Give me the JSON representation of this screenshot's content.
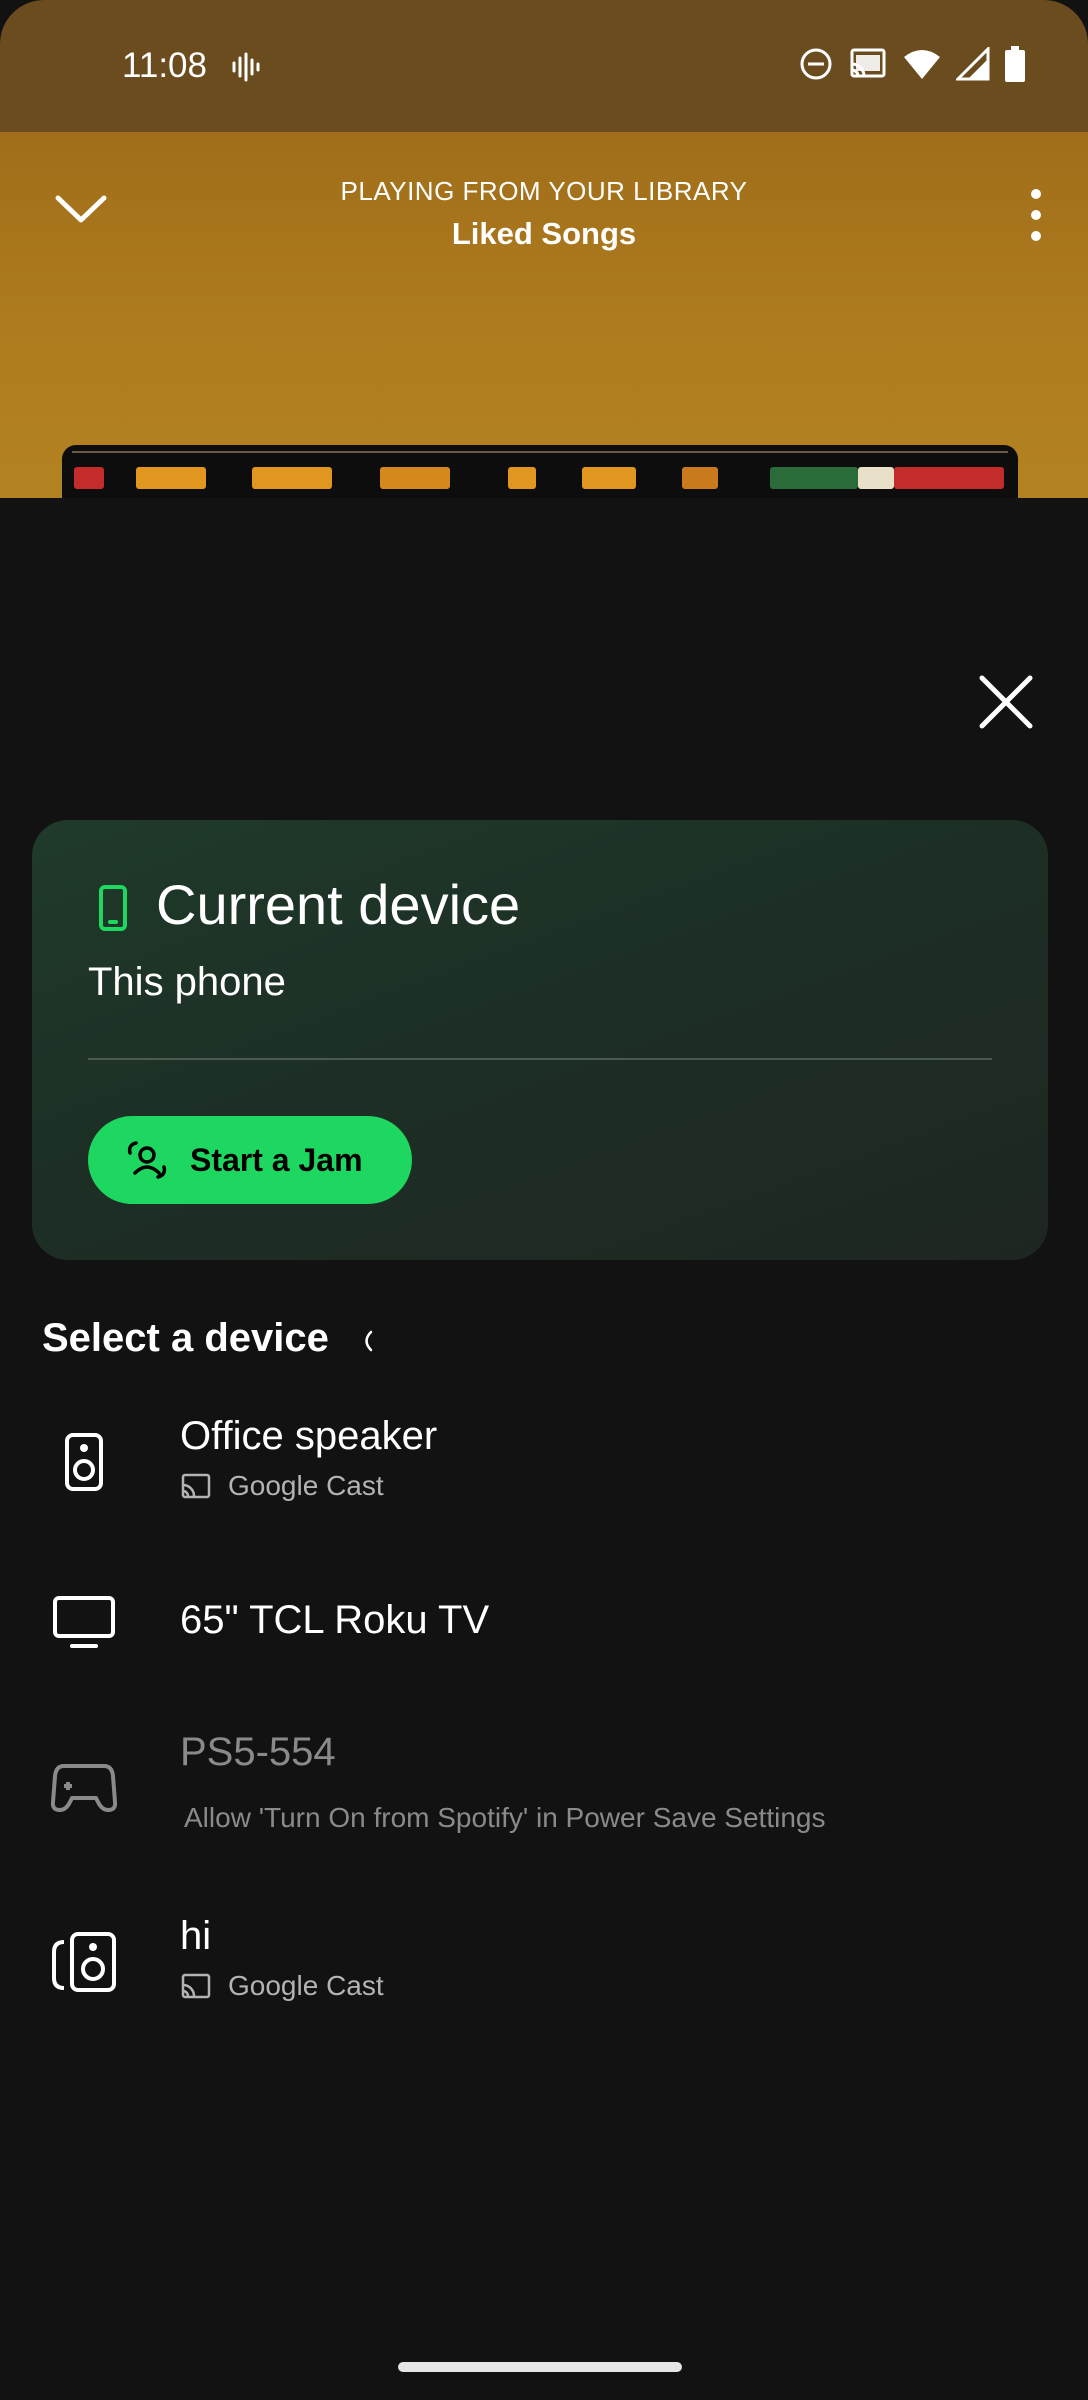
{
  "status_bar": {
    "time": "11:08",
    "icons": [
      "sound-wave-icon",
      "do-not-disturb-icon",
      "cast-icon",
      "wifi-icon",
      "signal-icon",
      "battery-icon"
    ]
  },
  "player": {
    "caption": "PLAYING FROM YOUR LIBRARY",
    "title": "Liked Songs"
  },
  "sheet": {
    "current_device": {
      "title": "Current device",
      "subtitle": "This phone",
      "jam_button": "Start a Jam"
    },
    "select_label": "Select a device",
    "devices": [
      {
        "name": "Office speaker",
        "sub": "Google Cast",
        "icon": "speaker-icon",
        "enabled": true
      },
      {
        "name": "65\" TCL Roku TV",
        "sub": "",
        "icon": "tv-icon",
        "enabled": true
      },
      {
        "name": "PS5-554",
        "sub": "Allow 'Turn On from Spotify' in Power Save Settings",
        "icon": "gamepad-icon",
        "enabled": false
      },
      {
        "name": "hi",
        "sub": "Google Cast",
        "icon": "speaker-group-icon",
        "enabled": true
      }
    ]
  },
  "colors": {
    "accent": "#1ed760",
    "header": "#b07d1f",
    "background": "#121212"
  }
}
